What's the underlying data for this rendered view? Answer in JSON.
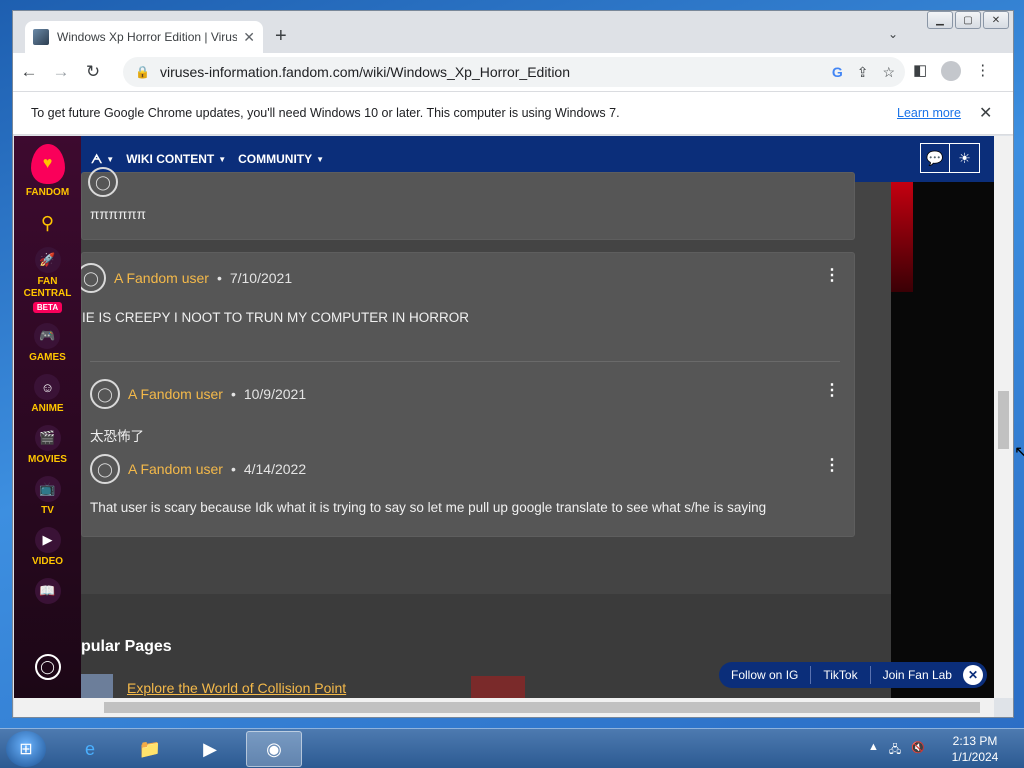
{
  "browser": {
    "tab_title": "Windows Xp Horror Edition | Virus",
    "url": "viruses-information.fandom.com/wiki/Windows_Xp_Horror_Edition",
    "infobar_message": "To get future Google Chrome updates, you'll need Windows 10 or later. This computer is using Windows 7.",
    "infobar_link": "Learn more"
  },
  "rail": {
    "logo_label": "FANDOM",
    "items": [
      {
        "label": "FAN CENTRAL",
        "badge": "BETA"
      },
      {
        "label": "GAMES"
      },
      {
        "label": "ANIME"
      },
      {
        "label": "MOVIES"
      },
      {
        "label": "TV"
      },
      {
        "label": "VIDEO"
      },
      {
        "label": "WIKIS"
      }
    ]
  },
  "wikinav": {
    "items": [
      {
        "label": "WIKI CONTENT"
      },
      {
        "label": "COMMUNITY"
      }
    ]
  },
  "comments": {
    "first_text": "ππππππ",
    "items": [
      {
        "user": "A Fandom user",
        "date": "7/10/2021",
        "text": "IE IS CREEPY I NOOT TO TRUN MY COMPUTER IN HORROR"
      },
      {
        "user": "A Fandom user",
        "date": "10/9/2021",
        "text": "太恐怖了"
      },
      {
        "user": "A Fandom user",
        "date": "4/14/2022",
        "text": "That user is scary because Idk what it is trying to say so let me pull up google translate to see what s/he is saying"
      }
    ]
  },
  "popular": {
    "heading": "pular Pages",
    "link": "Explore the World of Collision Point"
  },
  "social": {
    "ig": "Follow on IG",
    "tiktok": "TikTok",
    "fanlab": "Join Fan Lab"
  },
  "taskbar": {
    "time": "2:13 PM",
    "date": "1/1/2024"
  }
}
